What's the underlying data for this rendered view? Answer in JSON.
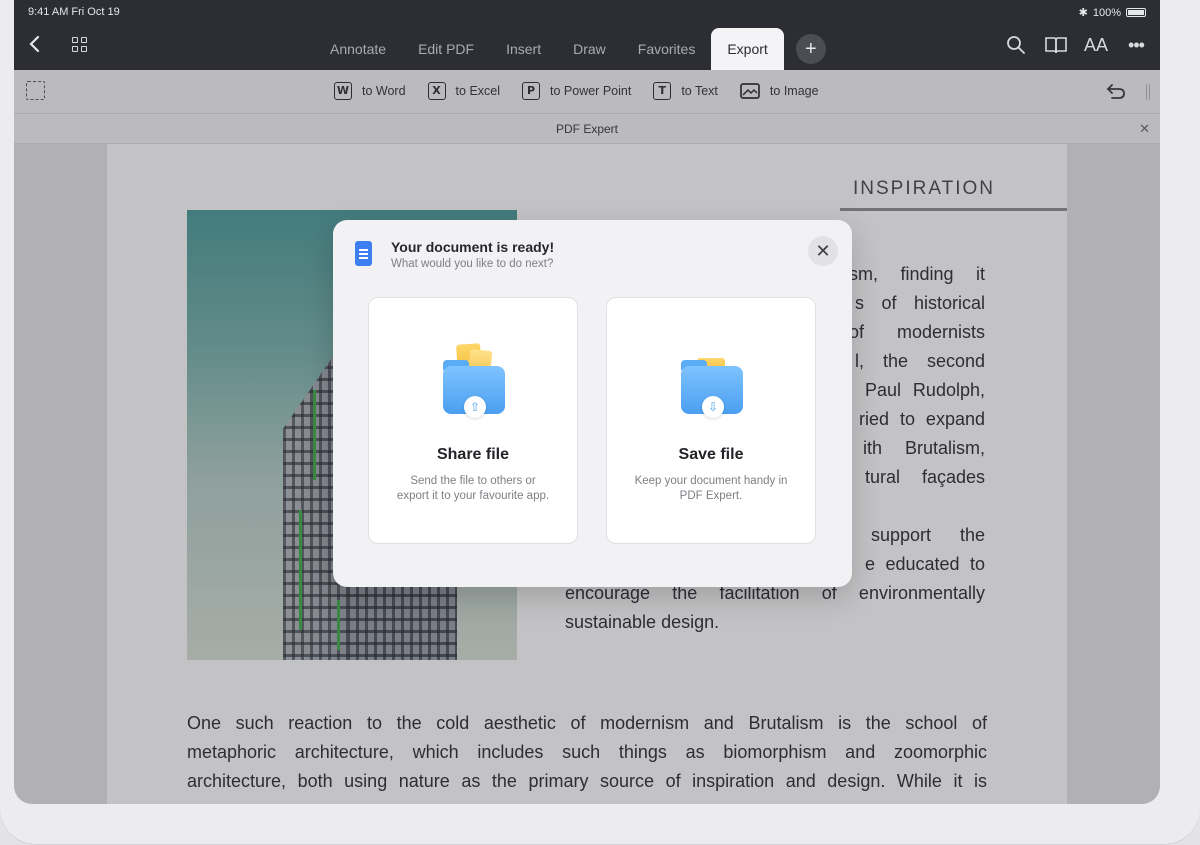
{
  "status": {
    "time": "9:41 AM  Fri Oct 19",
    "battery": "100%"
  },
  "nav": {
    "tabs": [
      "Annotate",
      "Edit PDF",
      "Insert",
      "Draw",
      "Favorites",
      "Export"
    ],
    "active_tab": "Export",
    "plus": "+",
    "text_size": "AA"
  },
  "export_bar": {
    "items": [
      {
        "letter": "W",
        "label": "to Word"
      },
      {
        "letter": "X",
        "label": "to Excel"
      },
      {
        "letter": "P",
        "label": "to Power Point"
      },
      {
        "letter": "T",
        "label": "to Text"
      },
      {
        "letter": "",
        "label": "to Image"
      }
    ]
  },
  "document": {
    "title": "PDF Expert",
    "heading": "INSPIRATION",
    "right_column_visible": [
      "sm, finding it",
      "s of historical",
      "of modernists",
      "l, the second",
      "Paul Rudolph,",
      "ried to expand",
      "ith Brutalism,",
      "tural façades",
      "",
      "support the",
      "e educated to",
      "encourage the facilitation of environmentally",
      "sustainable design."
    ],
    "bottom_paragraph": [
      "One such reaction to the cold aesthetic of modernism and Brutalism is the school of",
      "metaphoric architecture, which includes such things as biomorphism and zoomorphic",
      "architecture, both using nature as the primary source of inspiration and design. While it is"
    ]
  },
  "modal": {
    "title": "Your document is ready!",
    "subtitle": "What would you like to do next?",
    "close": "✕",
    "share": {
      "title": "Share file",
      "desc": "Send the file to others or export it to your favourite app."
    },
    "save": {
      "title": "Save file",
      "desc": "Keep your document handy in PDF Expert."
    }
  },
  "colors": {
    "topbar": "#2c2e33",
    "accent": "#3d7ef0",
    "folder": "#4a9ff0"
  }
}
